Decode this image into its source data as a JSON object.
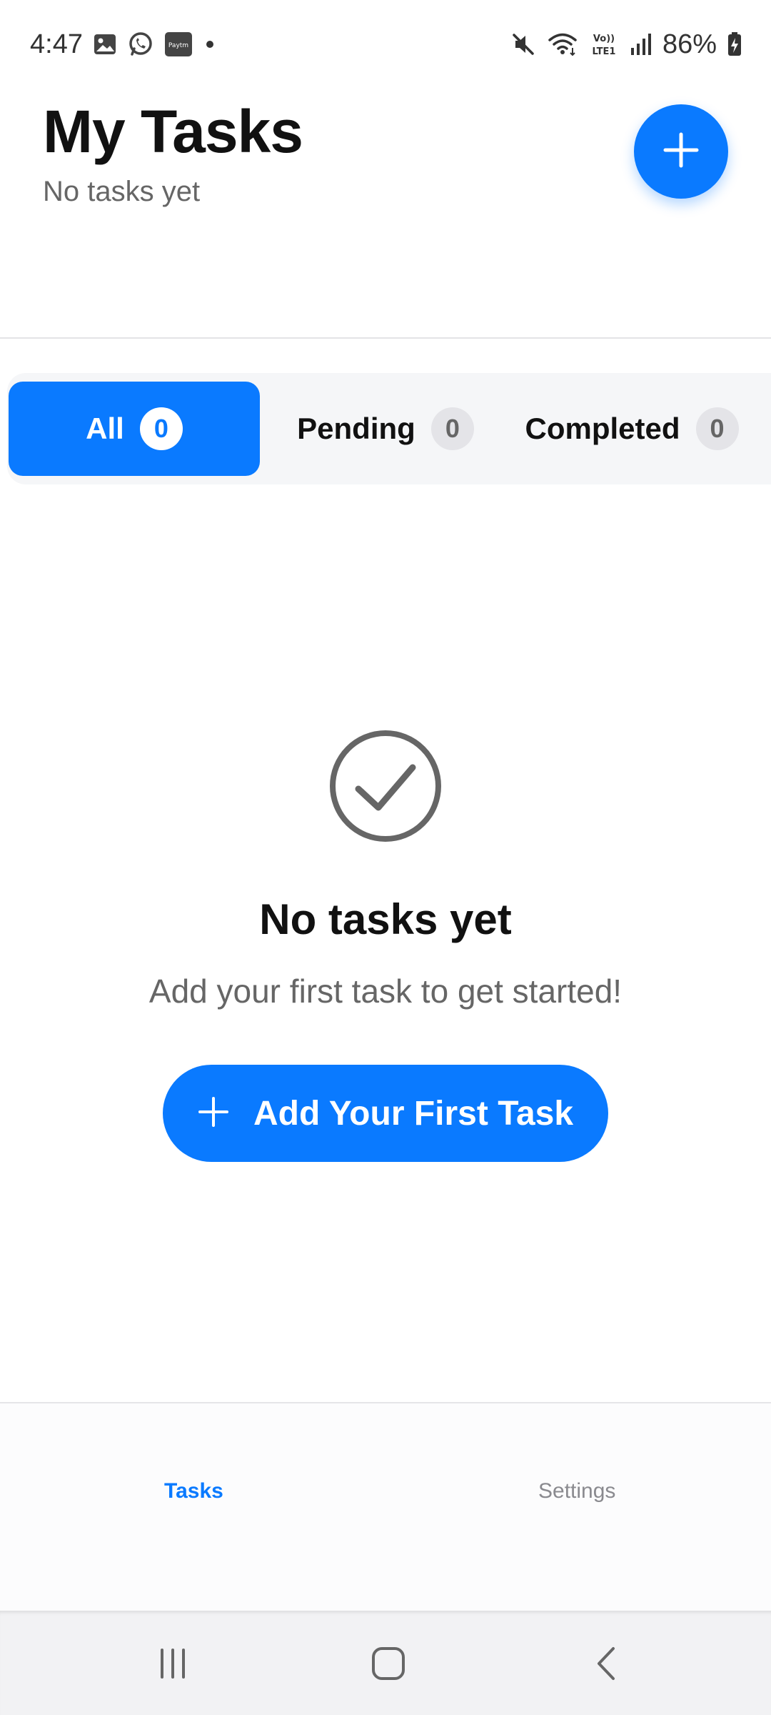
{
  "status_bar": {
    "time": "4:47",
    "battery_percent": "86%",
    "left_icons": [
      "gallery-icon",
      "whatsapp-icon",
      "paytm-icon",
      "notification-dot-icon"
    ],
    "right_icons": [
      "mute-icon",
      "wifi-icon",
      "volte-icon",
      "signal-icon",
      "battery-icon"
    ],
    "paytm_label": "Paytm",
    "volte_label": "Vo)) LTE1"
  },
  "header": {
    "title": "My Tasks",
    "subtitle": "No tasks yet",
    "add_icon": "plus-icon"
  },
  "filters": [
    {
      "label": "All",
      "count": "0",
      "active": true
    },
    {
      "label": "Pending",
      "count": "0",
      "active": false
    },
    {
      "label": "Completed",
      "count": "0",
      "active": false
    }
  ],
  "empty_state": {
    "icon": "check-circle-icon",
    "title": "No tasks yet",
    "message": "Add your first task to get started!",
    "button_label": "Add Your First Task",
    "button_icon": "plus-icon"
  },
  "bottom_nav": {
    "items": [
      {
        "label": "Tasks",
        "active": true
      },
      {
        "label": "Settings",
        "active": false
      }
    ]
  },
  "system_nav": [
    "recents-icon",
    "home-icon",
    "back-icon"
  ],
  "colors": {
    "accent": "#0a7aff",
    "text_primary": "#111111",
    "text_secondary": "#666666",
    "inactive_nav": "#8a8a8f"
  }
}
